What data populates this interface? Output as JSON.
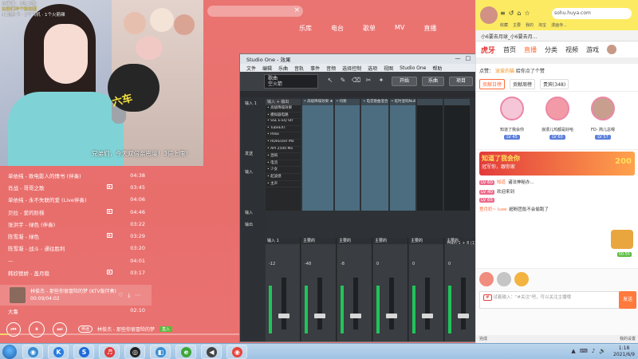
{
  "music_player": {
    "search_close": "×",
    "nav": [
      "乐库",
      "电台",
      "歌单",
      "MV",
      "直播"
    ],
    "songs": [
      {
        "title": "单依纯 - 致电影人的情书 (伴奏)",
        "duration": "04:38",
        "mv": false
      },
      {
        "title": "肖战 - 哥哥之歌",
        "duration": "03:45",
        "mv": true
      },
      {
        "title": "单依纯 - 永不失联的爱 (Live伴奏)",
        "duration": "04:06",
        "mv": false
      },
      {
        "title": "贝拉 - 爱的阶梯",
        "duration": "04:46",
        "mv": true
      },
      {
        "title": "张洪宇 - 绿色 (伴奏)",
        "duration": "03:22",
        "mv": false
      },
      {
        "title": "陈雪凝 - 绿色",
        "duration": "03:29",
        "mv": true
      },
      {
        "title": "陈雪凝 - 战斗 - 通往胜利",
        "duration": "03:20",
        "mv": false
      },
      {
        "title": "—",
        "duration": "04:01",
        "mv": false
      },
      {
        "title": "韩欣德娇 - 盖月稳",
        "duration": "03:17",
        "mv": true
      }
    ],
    "now_playing": {
      "title": "林俊杰 - 那些你很冒险的梦 (KTV版伴奏)",
      "time": "00:09/04:02",
      "icons": [
        "♡",
        "⤓",
        "⋯"
      ]
    },
    "last_song": {
      "title": "大鲁",
      "duration": "02:10"
    },
    "controls": {
      "prev": "⏮",
      "pause": "⏸",
      "next": "⏭"
    },
    "lyric_tag": "桦迷",
    "lyric_text": "林俊杰 - 那些你很冒险的梦",
    "lyric_badge": "直入",
    "progress": 0.037
  },
  "webcam": {
    "overlay_lines": [
      "兄弟们：3倍上限！",
      "兄弟们冲个粉丝团",
      "41张办卡 · 5个飞机 · 1个火箭厢"
    ],
    "mascot_text": "六车",
    "caption": "兄弟们，今天双倍亲密度！3倍上限！"
  },
  "studio": {
    "title": "Studio One - 效果",
    "window_buttons": [
      "—",
      "□",
      "×"
    ],
    "menu": [
      "文件",
      "编辑",
      "乐曲",
      "音轨",
      "事件",
      "音频",
      "选择控制",
      "选项",
      "视图",
      "Studio One",
      "帮助"
    ],
    "song_name": "歌曲",
    "song_sub": "空火箭",
    "tools": [
      "↖",
      "✎",
      "⌫",
      "✂",
      "✦",
      "⧗",
      "✎"
    ],
    "start_label": "开始",
    "music_label": "乐曲",
    "project_label": "项目",
    "browser_header": "输入 + 输出",
    "plugins": [
      "• 高级降噪效果",
      "• 模拟器电路",
      "• SSL E-EQ Str",
      "• TubeEXT",
      "• RVox",
      "• RDeEsser Mo",
      "• API 2500 Mo",
      "• 混响",
      "• 电流",
      "• 少女",
      "• 起波感",
      "• 主声"
    ],
    "channels": [
      {
        "name": "• 高级降噪效果 ★",
        "dark": false
      },
      {
        "name": "• 均衡",
        "dark": false
      },
      {
        "name": "• 电音歌曲混合",
        "dark": false
      },
      {
        "name": "• 延时混响Null",
        "dark": false
      },
      {
        "name": "",
        "dark": true
      },
      {
        "name": "",
        "dark": true
      }
    ],
    "left_inputs": [
      "输入 1",
      "",
      "",
      "",
      "",
      "",
      "",
      "",
      "",
      "",
      "",
      "",
      "",
      "",
      "发送",
      "",
      "",
      "",
      "输入",
      "",
      "",
      "",
      "",
      "",
      "",
      "",
      "",
      "",
      "",
      "输入",
      "",
      "输出"
    ],
    "strips": [
      {
        "name": "输入 1",
        "value": "-12"
      },
      {
        "name": "主要的",
        "value": "-48"
      },
      {
        "name": "主要的",
        "value": "-8"
      },
      {
        "name": "主要的",
        "value": "0"
      },
      {
        "name": "主要的",
        "value": "0"
      },
      {
        "name": "主要的",
        "value": "0"
      }
    ],
    "status_text": "Main 1 + 8 (1)"
  },
  "right_browser": {
    "nav_icons": [
      "≡",
      "↺",
      "⌂",
      "☆"
    ],
    "address": "sohu.huya.com",
    "bookmarks": [
      "收藏",
      "主要",
      "我的",
      "淘宝",
      "漫画寺..."
    ],
    "tab_title": "小6要去月球_小6要去月...",
    "site_logo": "虎牙",
    "site_nav": [
      "首页",
      "直播",
      "分类",
      "视频",
      "游戏"
    ],
    "site_active": "直播",
    "intimacy_label": "点赞：",
    "intimacy_value": "宠爱的猫",
    "intimacy_suffix": "给你点了个赞",
    "subtabs": [
      "贡献日榜",
      "贡献周榜",
      "贵宾(348)"
    ],
    "ranks": [
      {
        "name": "知道了我会你",
        "level": "LV 45"
      },
      {
        "name": "浪漫儿鸡都是好哈",
        "level": "LV 60"
      },
      {
        "name": "FD- 简儿总嗯",
        "level": "LV 57"
      }
    ],
    "banner_title": "知道了我会你",
    "banner_sub": "冠军你，跟你家",
    "banner_number": "200",
    "chat": [
      {
        "level": "LV 60",
        "nick": "知道",
        "text": "诸法神秘办...",
        "plain": false
      },
      {
        "level": "LV 40",
        "nick": "",
        "text": "欢迎来到",
        "plain": false
      },
      {
        "level": "LV 65",
        "nick": "",
        "text": "",
        "plain": false
      },
      {
        "level": "",
        "nick": "登月奶~ luxe",
        "text": "超粉团氪不会偷跑了",
        "plain": false
      }
    ],
    "chest_time": "00:55",
    "input_placeholder": "试着输入：\"#关注\"吧，可以关注主播哦",
    "input_tag": "#",
    "send_label": "发送",
    "footer_left": "完成",
    "footer_right": "我的设置"
  },
  "taskbar": {
    "icons": [
      {
        "glyph": "◉",
        "color": "#3a8bd0"
      },
      {
        "glyph": "K",
        "color": "#2a7de0"
      },
      {
        "glyph": "S",
        "color": "#1e6ad8"
      },
      {
        "glyph": "♬",
        "color": "#e23b3b"
      },
      {
        "glyph": "◎",
        "color": "#222"
      },
      {
        "glyph": "◧",
        "color": "#3c8ed1"
      },
      {
        "glyph": "e",
        "color": "#3ea63a"
      },
      {
        "glyph": "◀",
        "color": "#444"
      },
      {
        "glyph": "◉",
        "color": "#e8433a"
      }
    ],
    "tray": [
      "▲",
      "⌨",
      "♪",
      "🔊"
    ],
    "time": "1:18",
    "date": "2021/6/9"
  }
}
